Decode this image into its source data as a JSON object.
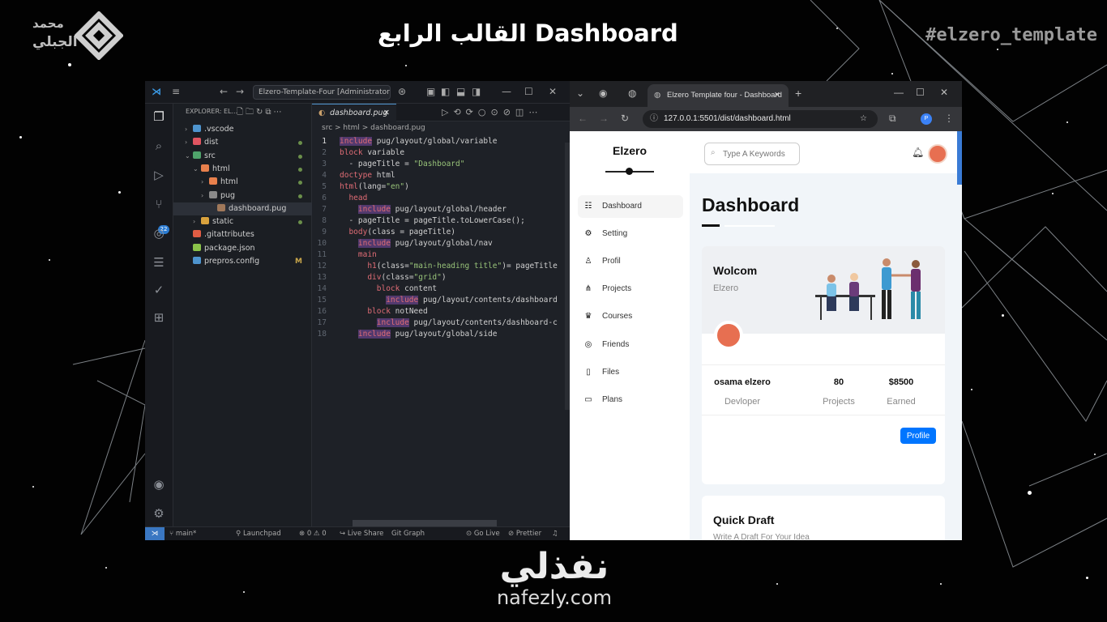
{
  "video": {
    "title": "القالب الرابع Dashboard",
    "hashtag": "#elzero_template",
    "brand_line1": "محمد",
    "brand_line2": "الجبلي",
    "footer_arabic": "نفذلي",
    "footer_url": "nafezly.com"
  },
  "vscode": {
    "search": "Elzero-Template-Four [Administrator]",
    "explorer_label": "EXPLORER: EL...",
    "scm_badge": "22",
    "tree": [
      {
        "label": ".vscode",
        "color": "#4e94ce"
      },
      {
        "label": "dist",
        "color": "#e05561"
      },
      {
        "label": "src",
        "color": "#4fa36b"
      },
      {
        "label": "html",
        "color": "#e8804c"
      },
      {
        "label": "html",
        "color": "#e8804c"
      },
      {
        "label": "pug",
        "color": "#8a8a8a"
      },
      {
        "label": "dashboard.pug",
        "color": "#a0785a"
      },
      {
        "label": "static",
        "color": "#d9a23d"
      },
      {
        "label": ".gitattributes",
        "color": "#e05d44"
      },
      {
        "label": "package.json",
        "color": "#8bc34a"
      },
      {
        "label": "prepros.config",
        "color": "#4e94ce",
        "mark": "M"
      }
    ],
    "tab": "dashboard.pug",
    "breadcrumb": "src > html > dashboard.pug",
    "code": [
      {
        "n": "1",
        "t": "include pug/layout/global/variable"
      },
      {
        "n": "2",
        "t": "block variable"
      },
      {
        "n": "3",
        "t": "  - pageTitle = \"Dashboard\""
      },
      {
        "n": "4",
        "t": "doctype html"
      },
      {
        "n": "5",
        "t": "html(lang=\"en\")"
      },
      {
        "n": "6",
        "t": "  head"
      },
      {
        "n": "7",
        "t": "    include pug/layout/global/header"
      },
      {
        "n": "8",
        "t": "  - pageTitle = pageTitle.toLowerCase();"
      },
      {
        "n": "9",
        "t": "  body(class = pageTitle)"
      },
      {
        "n": "10",
        "t": "    include pug/layout/global/nav"
      },
      {
        "n": "11",
        "t": "    main"
      },
      {
        "n": "12",
        "t": "      h1(class=\"main-heading title\")= pageTitle"
      },
      {
        "n": "13",
        "t": "      div(class=\"grid\")"
      },
      {
        "n": "14",
        "t": "        block content"
      },
      {
        "n": "15",
        "t": "          include pug/layout/contents/dashboard"
      },
      {
        "n": "16",
        "t": "      block notNeed"
      },
      {
        "n": "17",
        "t": "        include pug/layout/contents/dashboard-c"
      },
      {
        "n": "18",
        "t": "    include pug/layout/global/side"
      }
    ],
    "status": {
      "branch": "main*",
      "launchpad": "Launchpad",
      "problems": "⊗ 0 ⚠ 0",
      "live_share": "Live Share",
      "git_graph": "Git Graph",
      "go_live": "Go Live",
      "prettier": "Prettier"
    }
  },
  "browser": {
    "tab_title": "Elzero Template four - Dashboard",
    "url": "127.0.0.1:5501/dist/dashboard.html",
    "profile_letter": "P",
    "app": {
      "logo": "Elzero",
      "search_placeholder": "Type A Keywords",
      "nav": [
        "Dashboard",
        "Setting",
        "Profil",
        "Projects",
        "Courses",
        "Friends",
        "Files",
        "Plans"
      ],
      "page_title": "Dashboard",
      "welcome": {
        "title": "Wolcom",
        "subtitle": "Elzero",
        "name": "osama elzero",
        "name_label": "Devloper",
        "projects": "80",
        "projects_label": "Projects",
        "earned": "$8500",
        "earned_label": "Earned",
        "button": "Profile"
      },
      "quick_draft": {
        "title": "Quick Draft",
        "subtitle": "Write A Draft For Your Idea"
      }
    }
  }
}
